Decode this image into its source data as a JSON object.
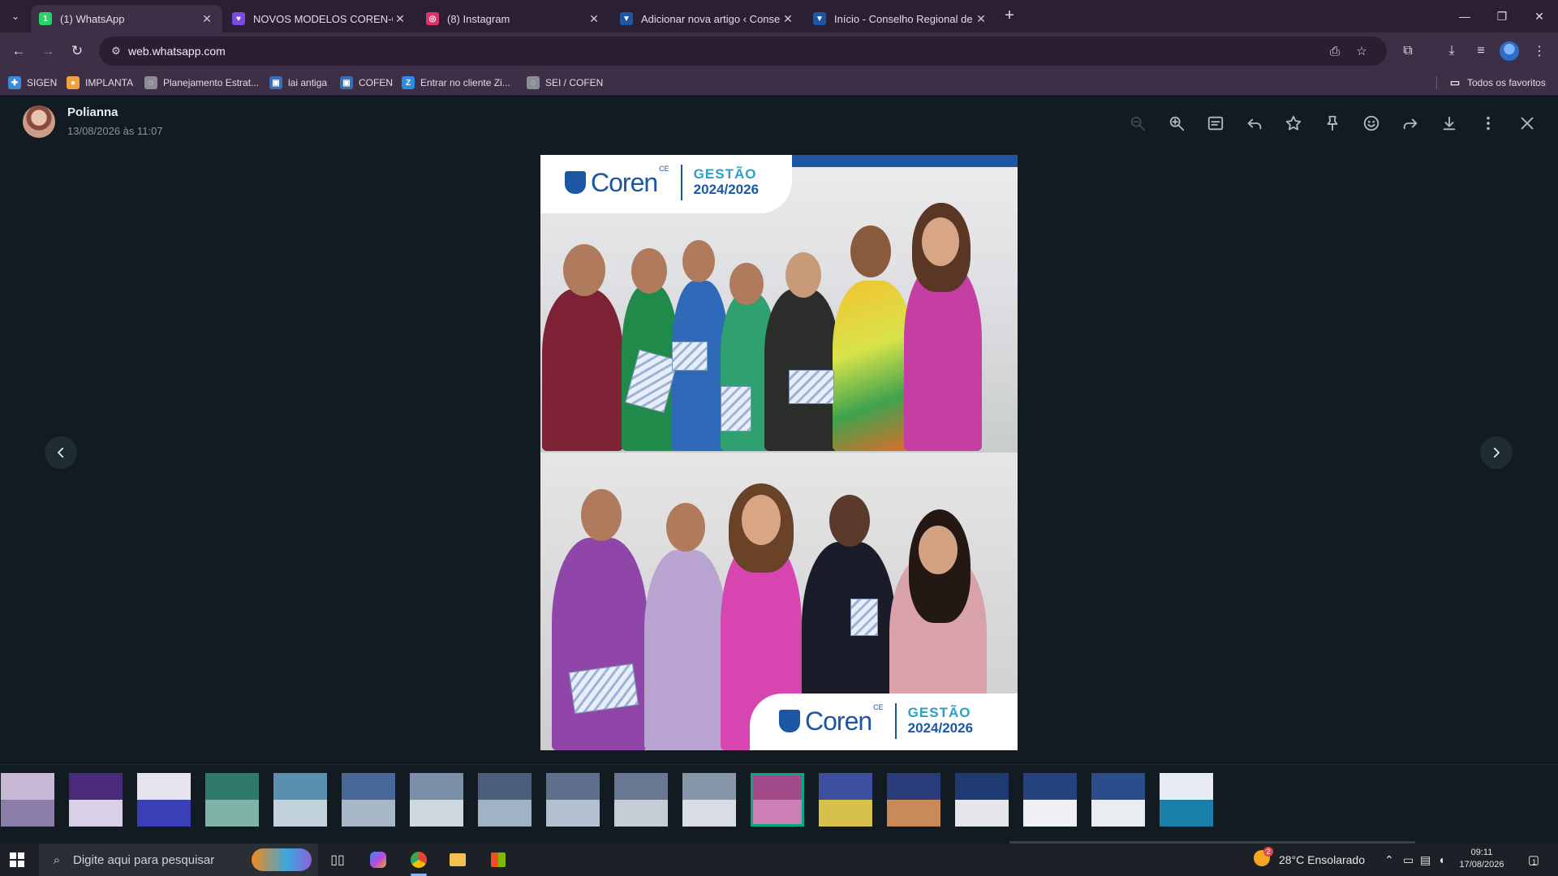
{
  "browser": {
    "tabs": [
      {
        "title": "(1) WhatsApp",
        "favicon_color": "#25d366",
        "favicon_glyph": "1",
        "active": true
      },
      {
        "title": "NOVOS MODELOS COREN-CE -",
        "favicon_color": "#7b4ae2",
        "favicon_glyph": "♥",
        "active": false
      },
      {
        "title": "(8) Instagram",
        "favicon_color": "#e1306c",
        "favicon_glyph": "◎",
        "active": false
      },
      {
        "title": "Adicionar nova artigo ‹ Conselh",
        "favicon_color": "#1d56a3",
        "favicon_glyph": "▼",
        "active": false
      },
      {
        "title": "Início - Conselho Regional de E",
        "favicon_color": "#1d56a3",
        "favicon_glyph": "▼",
        "active": false
      }
    ],
    "new_tab_glyph": "+",
    "url": "web.whatsapp.com",
    "bookmarks": [
      {
        "label": "SIGEN",
        "icon_color": "#3a8bd8",
        "glyph": "✚"
      },
      {
        "label": "IMPLANTA",
        "icon_color": "#f2a23a",
        "glyph": "●"
      },
      {
        "label": "Planejamento Estrat...",
        "icon_color": "#8a8f96",
        "glyph": "◌"
      },
      {
        "label": "lai antiga",
        "icon_color": "#3a6fb5",
        "glyph": "▣"
      },
      {
        "label": "COFEN",
        "icon_color": "#3a6fb5",
        "glyph": "▣"
      },
      {
        "label": "Entrar no cliente Zi...",
        "icon_color": "#2d8ce6",
        "glyph": "Z"
      },
      {
        "label": "SEI / COFEN",
        "icon_color": "#8a8f96",
        "glyph": "◌"
      }
    ],
    "all_bookmarks_label": "Todos os favoritos"
  },
  "viewer": {
    "sender_name": "Polianna",
    "timestamp": "13/08/2026 às 11:07",
    "accent_color": "#00a884",
    "image": {
      "logo_word": "Coren",
      "logo_superscript": "CE",
      "gestao_label": "GESTÃO",
      "gestao_years": "2024/2026"
    },
    "thumbnails_count": 18,
    "selected_thumbnail_index": 11
  },
  "taskbar": {
    "search_placeholder": "Digite aqui para pesquisar",
    "weather": "28°C  Ensolarado",
    "weather_badge": "2",
    "time": "09:11",
    "date": "17/08/2026",
    "notification_count": "1"
  }
}
